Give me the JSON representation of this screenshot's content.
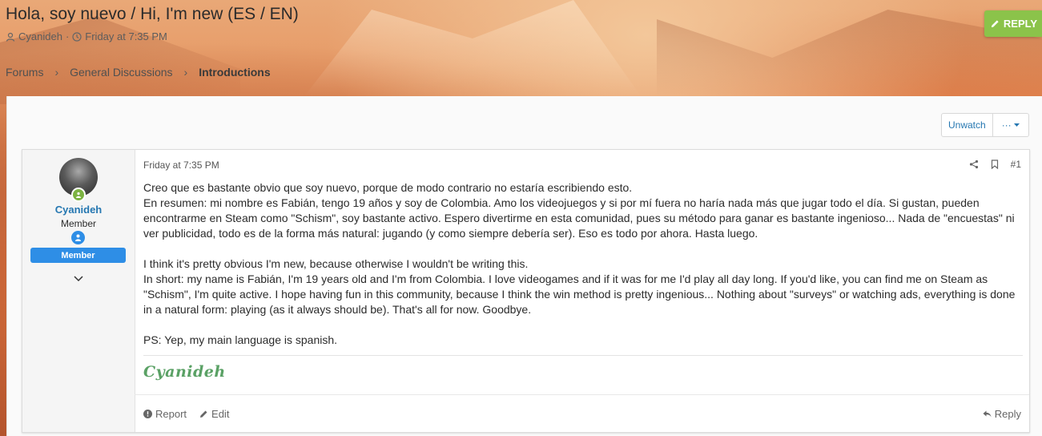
{
  "thread": {
    "title": "Hola, soy nuevo / Hi, I'm new (ES / EN)",
    "author": "Cyanideh",
    "date": "Friday at 7:35 PM",
    "separator": "·"
  },
  "actions": {
    "reply_top": "REPLY",
    "unwatch": "Unwatch",
    "more": "···"
  },
  "breadcrumb": {
    "items": [
      "Forums",
      "General Discussions",
      "Introductions"
    ],
    "separator": "›"
  },
  "post": {
    "user": {
      "name": "Cyanideh",
      "title": "Member",
      "banner": "Member"
    },
    "date": "Friday at 7:35 PM",
    "number": "#1",
    "body": {
      "es_1": "Creo que es bastante obvio que soy nuevo, porque de modo contrario no estaría escribiendo esto.",
      "es_2": "En resumen: mi nombre es Fabián, tengo 19 años y soy de Colombia. Amo los videojuegos y si por mí fuera no haría nada más que jugar todo el día. Si gustan, pueden encontrarme en Steam como \"Schism\", soy bastante activo. Espero divertirme en esta comunidad, pues su método para ganar es bastante ingenioso... Nada de \"encuestas\" ni ver publicidad, todo es de la forma más natural: jugando (y como siempre debería ser). Eso es todo por ahora. Hasta luego.",
      "en_1": "I think it's pretty obvious I'm new, because otherwise I wouldn't be writing this.",
      "en_2": "In short: my name is Fabián, I'm 19 years old and I'm from Colombia. I love videogames and if it was for me I'd play all day long. If you'd like, you can find me on Steam as \"Schism\", I'm quite active. I hope having fun in this community, because I think the win method is pretty ingenious... Nothing about \"surveys\" or watching ads, everything is done in a natural form: playing (as it always should be). That's all for now. Goodbye.",
      "ps": "PS: Yep, my main language is spanish."
    },
    "signature": "Cyanideh",
    "footer": {
      "report": "Report",
      "edit": "Edit",
      "reply": "Reply"
    }
  },
  "colors": {
    "accent_blue": "#2577b1",
    "reply_green": "#8bc34a",
    "banner_blue": "#2e8ee6",
    "signature_green": "#5aa165"
  },
  "icons": [
    "user-icon",
    "clock-icon",
    "pencil-icon",
    "chevron-right-icon",
    "caret-down-icon",
    "online-icon",
    "badge-icon",
    "chevron-down-icon",
    "share-icon",
    "bookmark-icon",
    "info-icon",
    "reply-icon"
  ]
}
